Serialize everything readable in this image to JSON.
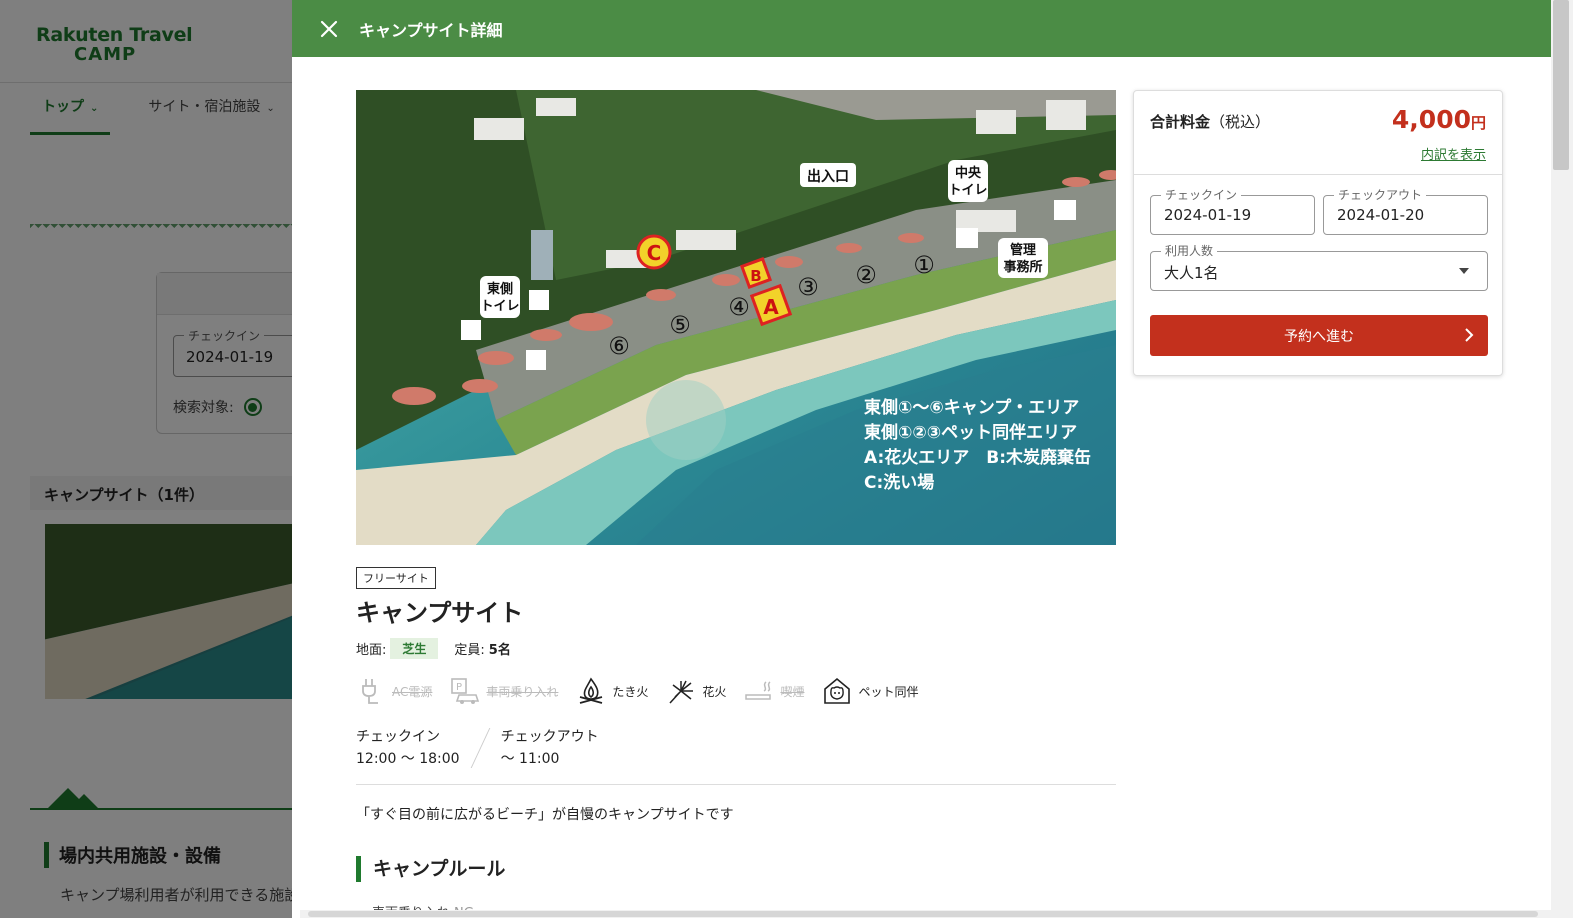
{
  "bg": {
    "logo_line1": "Rakuten Travel",
    "logo_line2": "CAMP",
    "nav": [
      "トップ",
      "サイト・宿泊施設"
    ],
    "checkin_label": "チェックイン",
    "checkin_value": "2024-01-19",
    "search_target_label": "検索対象:",
    "campsite_count": "キャンプサイト（1件）",
    "facilities_title": "場内共用施設・設備",
    "facilities_desc": "キャンプ場利用者が利用できる施設"
  },
  "modal": {
    "title": "キャンプサイト詳細",
    "photo_labels": {
      "entrance": "出入口",
      "central_toilet": "中央\nトイレ",
      "east_toilet": "東側\nトイレ",
      "office": "管理\n事務所",
      "legend_lines": [
        "東側①〜⑥キャンプ・エリア",
        "東側①②③ペット同伴エリア",
        "A:花火エリア　B:木炭廃棄缶",
        "C:洗い場"
      ]
    },
    "site_tag": "フリーサイト",
    "site_name": "キャンプサイト",
    "ground_label": "地面:",
    "ground_value": "芝生",
    "capacity_label": "定員:",
    "capacity_value": "5名",
    "features": [
      {
        "label": "AC電源",
        "icon": "plug-icon",
        "available": false
      },
      {
        "label": "車両乗り入れ",
        "icon": "car-parking-icon",
        "available": false
      },
      {
        "label": "たき火",
        "icon": "campfire-icon",
        "available": true
      },
      {
        "label": "花火",
        "icon": "fireworks-icon",
        "available": true
      },
      {
        "label": "喫煙",
        "icon": "smoking-icon",
        "available": false
      },
      {
        "label": "ペット同伴",
        "icon": "pet-icon",
        "available": true
      }
    ],
    "checkin_title": "チェックイン",
    "checkin_time": "12:00 〜 18:00",
    "checkout_title": "チェックアウト",
    "checkout_time": "〜 11:00",
    "description": "「すぐ目の前に広がるビーチ」が自慢のキャンプサイトです",
    "rules_title": "キャンプルール",
    "rule_item": "車両乗り入れ",
    "rule_value": "NG"
  },
  "price": {
    "label": "合計料金",
    "tax": "（税込）",
    "amount": "4,000",
    "currency": "円",
    "breakdown_link": "内訳を表示",
    "checkin_label": "チェックイン",
    "checkin_value": "2024-01-19",
    "checkout_label": "チェックアウト",
    "checkout_value": "2024-01-20",
    "guests_label": "利用人数",
    "guests_value": "大人1名",
    "reserve_button": "予約へ進む"
  },
  "colors": {
    "header_green": "#4b8c45",
    "brand_green": "#1f7a2e",
    "price_red": "#c3301d"
  }
}
